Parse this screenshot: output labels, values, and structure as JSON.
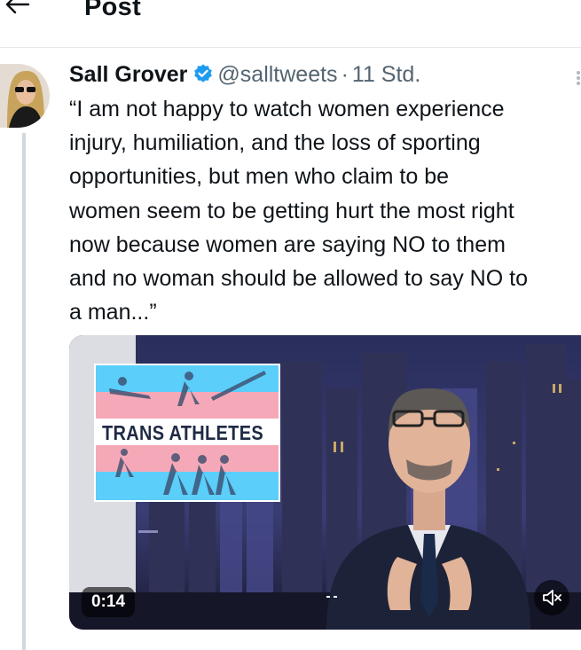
{
  "header": {
    "title": "Post",
    "back_icon": "arrow-left-icon"
  },
  "tweet": {
    "author_name": "Sall Grover",
    "verified_icon": "verified-badge-icon",
    "handle": "@salltweets",
    "separator": "·",
    "time": "11 Std.",
    "text": "“I am not happy to watch women experience\ninjury, humiliation, and the loss of sporting\nopportunities, but men who claim to be\nwomen seem to be getting hurt the most right\nnow because women are saying NO to them\nand no woman should be allowed to say NO to\na man...”"
  },
  "media": {
    "inset_text": "TRANS ATHLETES",
    "duration": "0:14",
    "mute_icon": "volume-muted-icon"
  },
  "colors": {
    "verified": "#1d9bf0",
    "muted_text": "#536471",
    "trans_blue": "#5bcefa",
    "trans_pink": "#f5a9b8"
  }
}
